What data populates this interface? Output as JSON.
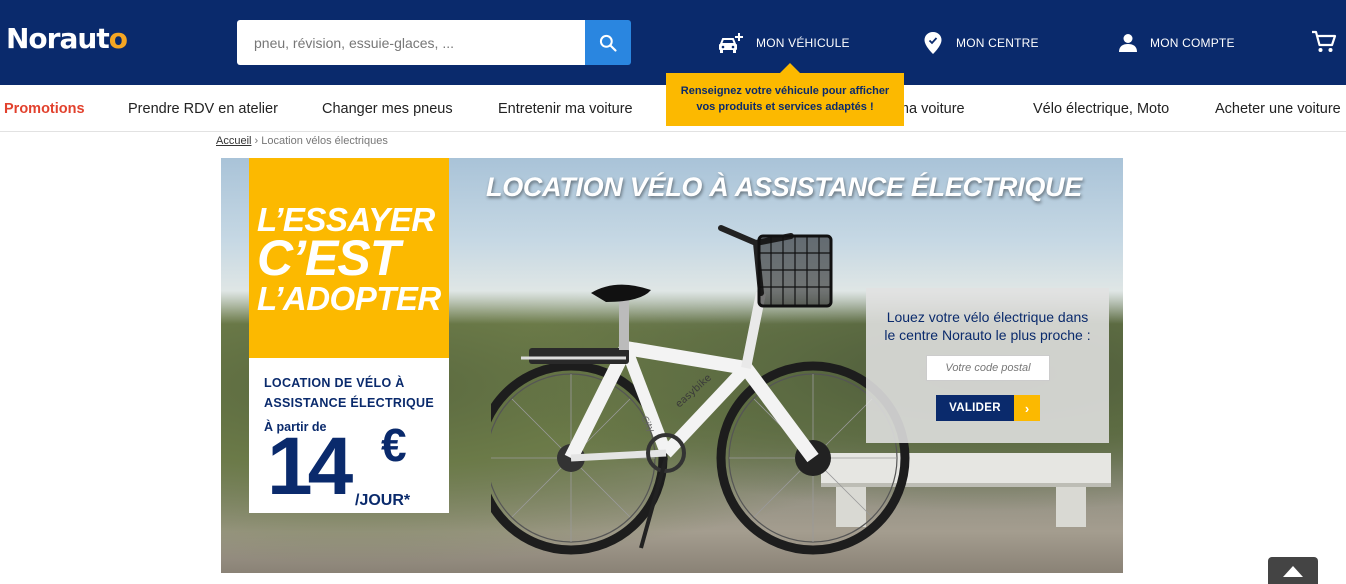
{
  "header": {
    "logo_main": "Norau",
    "logo_accent": "t",
    "logo_tail": "o",
    "search_placeholder": "pneu, révision, essuie-glaces, ...",
    "vehicule_label": "MON VÉHICULE",
    "centre_label": "MON CENTRE",
    "compte_label": "MON COMPTE"
  },
  "tooltip": {
    "line1": "Renseignez votre véhicule pour afficher",
    "line2": "vos produits et services adaptés !"
  },
  "nav": {
    "items": [
      "Promotions",
      "Prendre RDV en atelier",
      "Changer mes pneus",
      "Entretenir ma voiture",
      "er ma voiture",
      "Vélo électrique, Moto",
      "Acheter une voiture"
    ]
  },
  "breadcrumb": {
    "home": "Accueil",
    "separator": "›",
    "current": "Location vélos électriques"
  },
  "banner": {
    "title": "LOCATION VÉLO À ASSISTANCE ÉLECTRIQUE",
    "slogan_1": "L’ESSAYER",
    "slogan_2": "C’EST",
    "slogan_3": "L’ADOPTER",
    "promo_line_1": "LOCATION DE VÉLO À",
    "promo_line_2": "ASSISTANCE ÉLECTRIQUE",
    "promo_from": "À partir de",
    "promo_price": "14",
    "promo_currency": "€",
    "promo_unit": "/JOUR*",
    "bike_brand": "easybike",
    "bike_model": "City"
  },
  "panel": {
    "line1": "Louez votre vélo électrique dans",
    "line2": "le centre Norauto le plus proche :",
    "postal_placeholder": "Votre code postal",
    "submit_label": "VALIDER",
    "submit_arrow": "›"
  },
  "colors": {
    "brand_blue": "#0a2a6c",
    "brand_yellow": "#fcb900",
    "search_blue": "#2a86e0",
    "promo_red": "#e2412d"
  }
}
